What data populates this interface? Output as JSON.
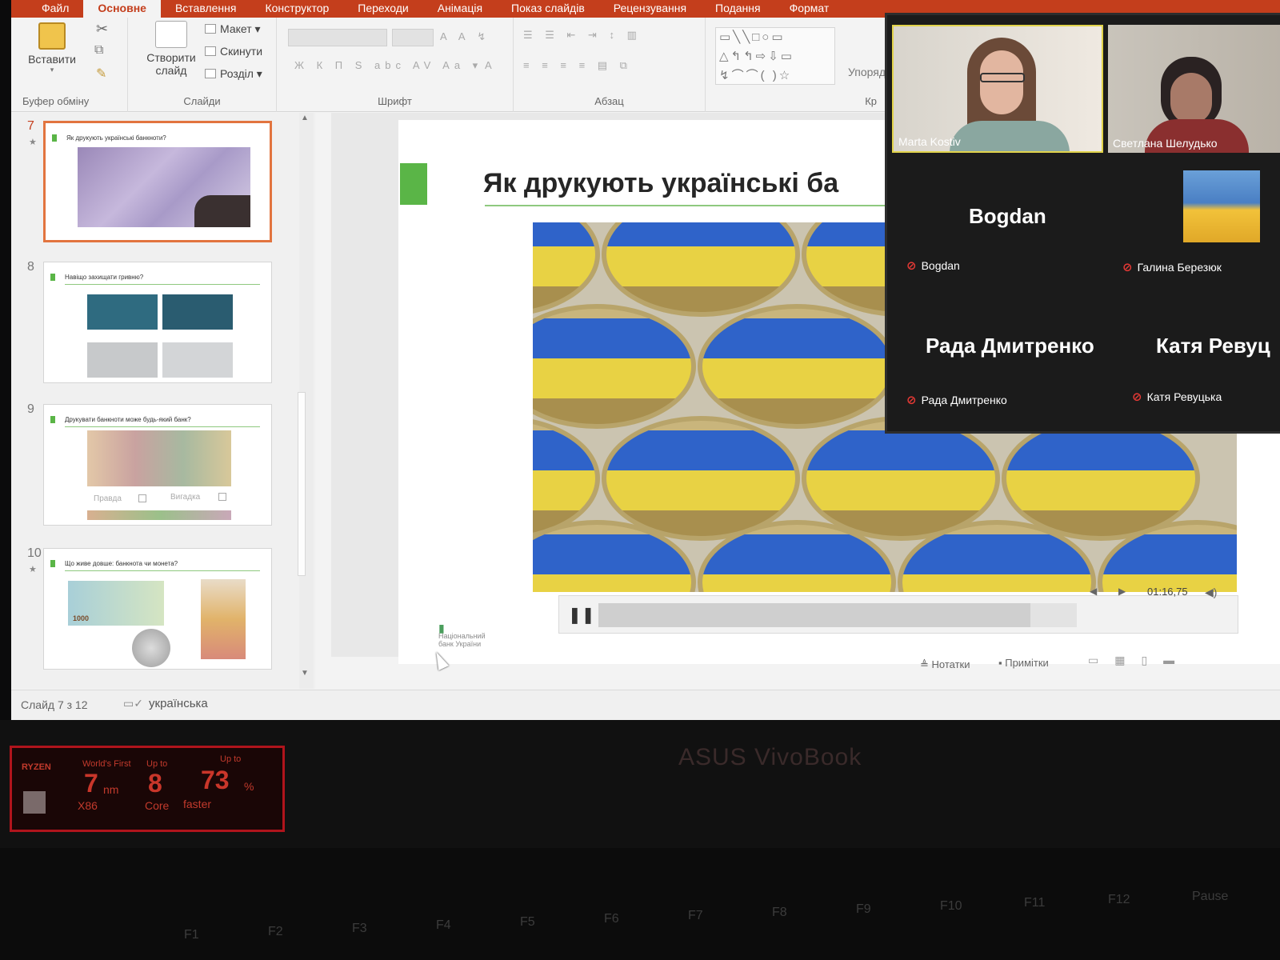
{
  "app": {
    "tabs": [
      "Файл",
      "Основне",
      "Вставлення",
      "Конструктор",
      "Переходи",
      "Анімація",
      "Показ слайдів",
      "Рецензування",
      "Подання",
      "Формат"
    ],
    "active_tab": "Основне",
    "accent_color": "#c43e1c"
  },
  "ribbon": {
    "clipboard": {
      "paste": "Вставити",
      "group_label": "Буфер обміну"
    },
    "slides": {
      "new_slide_line1": "Створити",
      "new_slide_line2": "слайд",
      "layout": "Макет",
      "reset": "Скинути",
      "section": "Розділ",
      "group_label": "Слайди"
    },
    "font": {
      "group_label": "Шрифт"
    },
    "paragraph": {
      "group_label": "Абзац"
    },
    "drawing": {
      "arrange": "Упоряд",
      "group_label_partial": "Кр"
    }
  },
  "thumbnails": [
    {
      "number": "7",
      "title": "Як друкують українські банкноти?",
      "selected": true
    },
    {
      "number": "8",
      "title": "Навіщо захищати гривню?",
      "selected": false
    },
    {
      "number": "9",
      "title": "Друкувати банкноти може будь-який банк?",
      "selected": false,
      "options": [
        "Правда",
        "Вигадка"
      ]
    },
    {
      "number": "10",
      "title": "Що живе довше: банкнота чи монета?",
      "selected": false,
      "note_amount": "1000"
    }
  ],
  "slide": {
    "title": "Як друкують українські ба",
    "video_time": "01:16,75",
    "logo_line1": "Національний",
    "logo_line2": "банк України"
  },
  "status_bar": {
    "slide_indicator": "Слайд 7 з 12",
    "language": "українська",
    "notes": "Нотатки",
    "comments": "Примітки"
  },
  "zoom": {
    "participants": [
      {
        "name": "Marta Kostiv",
        "video": true
      },
      {
        "name": "Светлана Шелудько",
        "video": true
      },
      {
        "name": "Bogdan",
        "display": "Bogdan",
        "muted": true
      },
      {
        "name": "Галина Березюк",
        "muted": true
      },
      {
        "name": "Рада Дмитренко",
        "display": "Рада Дмитренко",
        "muted": true
      },
      {
        "name": "Катя Ревуцька",
        "display": "Катя Ревуц",
        "muted": true
      }
    ]
  },
  "laptop": {
    "brand": "ASUS VivoBook",
    "sticker": {
      "brand": "RYZEN",
      "a1": "World's First",
      "a2": "7",
      "a3": "nm",
      "a4": "X86",
      "b1": "Up to",
      "b2": "8",
      "b3": "Core",
      "c1": "Up to",
      "c2": "73",
      "c3": "%",
      "c4": "faster"
    },
    "fn_keys": [
      "F1",
      "F2",
      "F3",
      "F4",
      "F5",
      "F6",
      "F7",
      "F8",
      "F9",
      "F10",
      "F11",
      "F12",
      "Pause"
    ]
  }
}
